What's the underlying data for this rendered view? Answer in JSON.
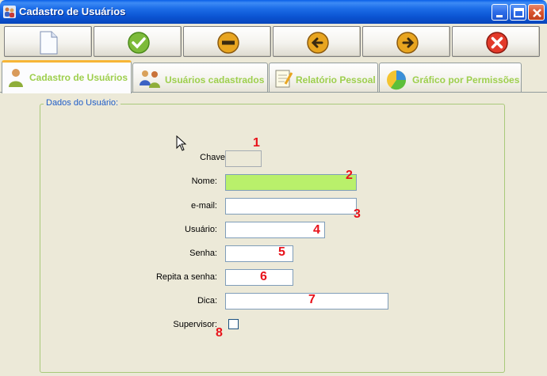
{
  "window": {
    "title": "Cadastro de Usuários"
  },
  "toolbar": {
    "buttons": [
      {
        "icon": "new-document-icon"
      },
      {
        "icon": "confirm-check-icon"
      },
      {
        "icon": "remove-minus-icon"
      },
      {
        "icon": "previous-arrow-icon"
      },
      {
        "icon": "next-arrow-icon"
      },
      {
        "icon": "cancel-x-icon"
      }
    ]
  },
  "tabs": [
    {
      "label": "Cadastro de Usuários",
      "active": true
    },
    {
      "label": "Usuários cadastrados",
      "active": false
    },
    {
      "label": "Relatório Pessoal",
      "active": false
    },
    {
      "label": "Gráfico por Permissões",
      "active": false
    }
  ],
  "form": {
    "group_title": "Dados do Usuário:",
    "fields": {
      "chave": {
        "label": "Chave:",
        "value": ""
      },
      "nome": {
        "label": "Nome:",
        "value": ""
      },
      "email": {
        "label": "e-mail:",
        "value": ""
      },
      "usuario": {
        "label": "Usuário:",
        "value": ""
      },
      "senha": {
        "label": "Senha:",
        "value": ""
      },
      "repita_senha": {
        "label": "Repita a senha:",
        "value": ""
      },
      "dica": {
        "label": "Dica:",
        "value": ""
      },
      "supervisor": {
        "label": "Supervisor:",
        "checked": false
      }
    }
  },
  "annotations": [
    "1",
    "2",
    "3",
    "4",
    "5",
    "6",
    "7",
    "8"
  ],
  "colors": {
    "focused_field": "#b9f06b",
    "tab_label": "#9ecf4e",
    "annotation": "#e8121a",
    "group_title": "#1f5dc8"
  }
}
